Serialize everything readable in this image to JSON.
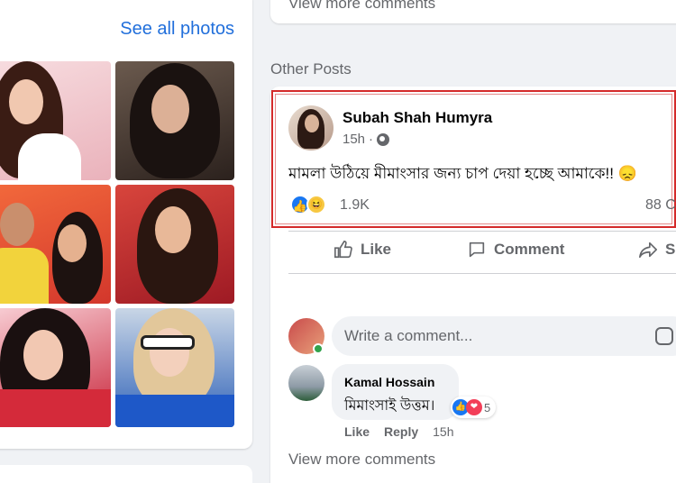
{
  "photos": {
    "see_all_label": "See all photos",
    "items": [
      {
        "name": "photo-1",
        "bg": "#f3c9cf"
      },
      {
        "name": "photo-2",
        "bg": "#4a3c36"
      },
      {
        "name": "photo-3",
        "bg": "#e24b34"
      },
      {
        "name": "photo-4",
        "bg": "#c41f2c"
      },
      {
        "name": "photo-5",
        "bg": "#c8253a"
      },
      {
        "name": "photo-6",
        "bg": "#2f62b8"
      }
    ]
  },
  "top_card": {
    "view_more": "View more comments"
  },
  "other_posts_label": "Other Posts",
  "post": {
    "author": "Subah Shah Humyra",
    "time": "15h",
    "text": "মামলা উঠিয়ে মীমাংসার জন্য চাপ দেয়া হচ্ছে আমাকে!!",
    "text_emoji": "😞",
    "reaction_count": "1.9K",
    "comment_count": "88 C",
    "actions": {
      "like": "Like",
      "comment": "Comment",
      "share": "S"
    }
  },
  "comment_box": {
    "placeholder": "Write a comment..."
  },
  "comment": {
    "author": "Kamal Hossain",
    "text": "মিমাংসাই উত্তম।",
    "reactions": "5",
    "like": "Like",
    "reply": "Reply",
    "time": "15h"
  },
  "bottom": {
    "view_more": "View more comments"
  },
  "colors": {
    "accent": "#216fdb",
    "highlight_border": "#d42a2a",
    "like_blue": "#1877f2",
    "muted": "#65676b"
  }
}
